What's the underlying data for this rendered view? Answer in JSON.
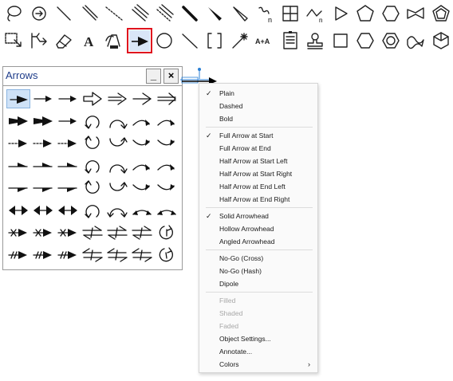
{
  "toolbar": {
    "row1": [
      "lasso-icon",
      "rotate-icon",
      "line-icon",
      "double-line-icon",
      "dashed-bond-icon",
      "triple-line-icon",
      "dotted-triple-icon",
      "bold-line-icon",
      "wedge-icon",
      "hashed-wedge-icon",
      "wavy-bond-icon",
      "table-icon",
      "chain-icon",
      "play-triangle-icon",
      "pentagon-icon",
      "hexagon-icon",
      "bow-icon",
      "pentagon-filled-icon"
    ],
    "row2": [
      "marquee-icon",
      "structure-perspective-icon",
      "eraser-icon",
      "text-icon",
      "pen-icon",
      "arrow-tool-icon",
      "orbital-icon",
      "graphic-line-icon",
      "bracket-icon",
      "sparkle-icon",
      "reaction-arrow-text-icon",
      "document-icon",
      "stamp-icon",
      "rectangle-icon",
      "hexagon-outline-icon",
      "hexagon-round-icon",
      "wavy-shape-icon",
      "cube-icon"
    ],
    "selected_tool": "arrow-tool-icon",
    "text_tool_glyph": "A",
    "reaction_text_glyph": "A+A"
  },
  "palette": {
    "title": "Arrows",
    "minimize_label": "_",
    "close_label": "×",
    "selected_cell": "plain-arrow",
    "rows": [
      [
        "plain-arrow",
        "thin-arrow",
        "thin-arrow",
        "hollow-arrow",
        "hollow-arrow-double",
        "open-arrow",
        "open-arrow-double"
      ],
      [
        "bold-arrow",
        "bold-arrow",
        "arrow",
        "curved-up-arrow",
        "curved-right-arrow",
        "curved-small-arrow",
        "curved-small-arrow"
      ],
      [
        "dashed-arrow",
        "dashed-arrow",
        "dashed-arrow",
        "curved-down-arrow",
        "curved-u-arrow",
        "curved-down-small-arrow",
        "curved-down-small-arrow"
      ],
      [
        "half-arrow",
        "half-arrow",
        "half-arrow",
        "curved-up-arrow",
        "curved-right-arrow",
        "curved-small-arrow",
        "curved-small-arrow"
      ],
      [
        "half-arrow-lower",
        "half-arrow-lower",
        "half-arrow-lower",
        "curved-down-arrow",
        "curved-u-arrow",
        "curved-down-small-arrow",
        "curved-down-small-arrow"
      ],
      [
        "double-headed-arrow",
        "double-headed-arrow",
        "double-headed-arrow",
        "curved-up-arrow",
        "curved-double-arrow",
        "double-curved-arrow",
        "double-curved-arrow"
      ],
      [
        "no-go-cross-arrow",
        "no-go-cross-arrow",
        "no-go-cross-arrow",
        "equilibrium-arrow",
        "equilibrium-arrow",
        "equilibrium-arrow",
        "circle-arrow"
      ],
      [
        "no-go-hash-arrow",
        "no-go-hash-arrow",
        "no-go-hash-arrow",
        "equilibrium-arrow-rev",
        "equilibrium-arrow-rev",
        "equilibrium-arrow-rev",
        "circle-arrow-2"
      ]
    ]
  },
  "menu": {
    "items": [
      {
        "label": "Plain",
        "checked": true,
        "disabled": false
      },
      {
        "label": "Dashed",
        "checked": false,
        "disabled": false
      },
      {
        "label": "Bold",
        "checked": false,
        "disabled": false
      },
      {
        "sep": true
      },
      {
        "label": "Full Arrow at Start",
        "checked": true,
        "disabled": false
      },
      {
        "label": "Full Arrow at End",
        "checked": false,
        "disabled": false
      },
      {
        "label": "Half Arrow at Start Left",
        "checked": false,
        "disabled": false
      },
      {
        "label": "Half Arrow at Start Right",
        "checked": false,
        "disabled": false
      },
      {
        "label": "Half Arrow at End Left",
        "checked": false,
        "disabled": false
      },
      {
        "label": "Half Arrow at End Right",
        "checked": false,
        "disabled": false
      },
      {
        "sep": true
      },
      {
        "label": "Solid Arrowhead",
        "checked": true,
        "disabled": false
      },
      {
        "label": "Hollow Arrowhead",
        "checked": false,
        "disabled": false
      },
      {
        "label": "Angled Arrowhead",
        "checked": false,
        "disabled": false
      },
      {
        "sep": true
      },
      {
        "label": "No-Go (Cross)",
        "checked": false,
        "disabled": false
      },
      {
        "label": "No-Go (Hash)",
        "checked": false,
        "disabled": false
      },
      {
        "label": "Dipole",
        "checked": false,
        "disabled": false
      },
      {
        "sep": true
      },
      {
        "label": "Filled",
        "checked": false,
        "disabled": true
      },
      {
        "label": "Shaded",
        "checked": false,
        "disabled": true
      },
      {
        "label": "Faded",
        "checked": false,
        "disabled": true
      },
      {
        "label": "Object Settings...",
        "checked": false,
        "disabled": false
      },
      {
        "label": "Annotate...",
        "checked": false,
        "disabled": false
      },
      {
        "label": "Colors",
        "checked": false,
        "disabled": false,
        "submenu": true
      }
    ],
    "check_glyph": "✓",
    "submenu_glyph": "›"
  },
  "colors": {
    "highlight_border": "#e0141e",
    "selection_fill": "#cfe2f7",
    "title_text": "#1f3d8a",
    "handle_blue": "#2a7fd4"
  }
}
